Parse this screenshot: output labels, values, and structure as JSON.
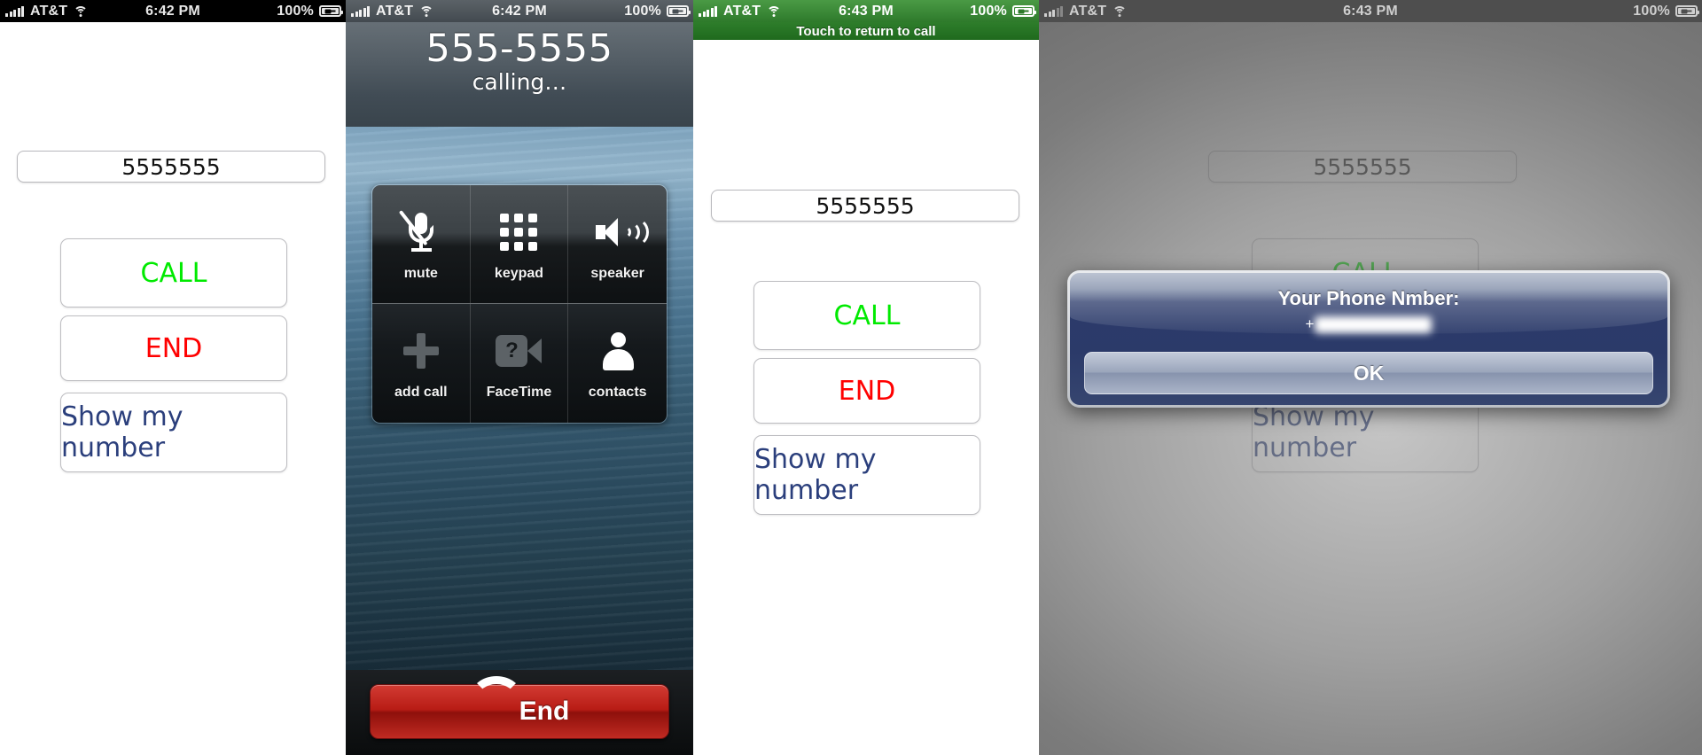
{
  "panels": [
    {
      "id": "dialer-initial",
      "statusbar": {
        "carrier": "AT&T",
        "time": "6:42 PM",
        "battery": "100%",
        "style": "black"
      },
      "number_field": "5555555",
      "buttons": {
        "call": "CALL",
        "end": "END",
        "show": "Show my number"
      }
    },
    {
      "id": "in-call",
      "statusbar": {
        "carrier": "AT&T",
        "time": "6:42 PM",
        "battery": "100%",
        "style": "gray"
      },
      "call": {
        "number": "555-5555",
        "status": "calling…",
        "keys": [
          {
            "label": "mute",
            "icon": "microphone-muted-icon"
          },
          {
            "label": "keypad",
            "icon": "keypad-icon"
          },
          {
            "label": "speaker",
            "icon": "speaker-icon"
          },
          {
            "label": "add call",
            "icon": "plus-icon"
          },
          {
            "label": "FaceTime",
            "icon": "facetime-video-icon"
          },
          {
            "label": "contacts",
            "icon": "contacts-person-icon"
          }
        ],
        "end_button": "End"
      }
    },
    {
      "id": "dialer-during-call",
      "statusbar": {
        "carrier": "AT&T",
        "time": "6:43 PM",
        "battery": "100%",
        "style": "green"
      },
      "banner": "Touch to return to call",
      "number_field": "5555555",
      "buttons": {
        "call": "CALL",
        "end": "END",
        "show": "Show my number"
      }
    },
    {
      "id": "dialer-alert",
      "statusbar": {
        "carrier": "AT&T",
        "time": "6:43 PM",
        "battery": "100%",
        "style": "dim"
      },
      "number_field": "5555555",
      "buttons": {
        "call": "CALL",
        "end": "END",
        "show": "Show my number"
      },
      "alert": {
        "title": "Your Phone Nmber:",
        "message_prefix": "+",
        "message_redacted": true,
        "ok": "OK"
      }
    }
  ],
  "colors": {
    "call_green": "#00ea00",
    "end_red": "#ff0000",
    "link_blue": "#2b3f7c",
    "banner_green": "#2e7d2b",
    "end_button_red": "#b81c15"
  }
}
